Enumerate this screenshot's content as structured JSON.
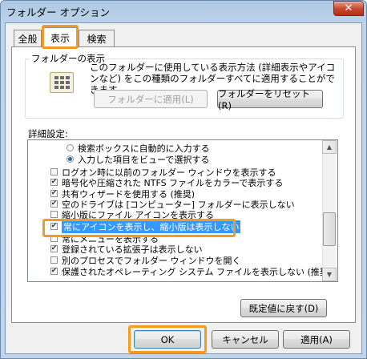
{
  "window": {
    "title": "フォルダー オプション",
    "close_glyph": "✕"
  },
  "tabs": [
    "全般",
    "表示",
    "検索"
  ],
  "folder_view": {
    "group_label": "フォルダーの表示",
    "description": "このフォルダーに使用している表示方法 (詳細表示やアイコンなど) をこの種類のフォルダーすべてに適用することができます。",
    "apply_button": "フォルダーに適用(L)",
    "reset_button": "フォルダーをリセット(R)"
  },
  "advanced": {
    "label": "詳細設定:",
    "items": [
      {
        "type": "radio",
        "checked": false,
        "label": "検索ボックスに自動的に入力する"
      },
      {
        "type": "radio",
        "checked": true,
        "label": "入力した項目をビューで選択する"
      },
      {
        "type": "checkbox",
        "checked": false,
        "label": "ログオン時に以前のフォルダー ウィンドウを表示する"
      },
      {
        "type": "checkbox",
        "checked": true,
        "label": "暗号化や圧縮された NTFS ファイルをカラーで表示する"
      },
      {
        "type": "checkbox",
        "checked": true,
        "label": "共有ウィザードを使用する (推奨)"
      },
      {
        "type": "checkbox",
        "checked": true,
        "label": "空のドライブは [コンピューター] フォルダーに表示しない"
      },
      {
        "type": "checkbox",
        "checked": false,
        "label": "縮小版にファイル アイコンを表示する"
      },
      {
        "type": "checkbox",
        "checked": true,
        "label": "常にアイコンを表示し、縮小版は表示しない"
      },
      {
        "type": "checkbox",
        "checked": false,
        "label": "常にメニューを表示する"
      },
      {
        "type": "checkbox",
        "checked": true,
        "label": "登録されている拡張子は表示しない"
      },
      {
        "type": "checkbox",
        "checked": false,
        "label": "別のプロセスでフォルダー ウィンドウを開く"
      },
      {
        "type": "checkbox",
        "checked": true,
        "label": "保護されたオペレーティング システム ファイルを表示しない (推奨)"
      }
    ],
    "restore_defaults": "既定値に戻す(D)"
  },
  "footer": {
    "ok": "OK",
    "cancel": "キャンセル",
    "apply": "適用(A)"
  },
  "check_glyph": "✔",
  "scroll": {
    "up": "▲",
    "down": "▼"
  },
  "colors": {
    "highlight": "#f39a22",
    "selection": "#3399ff"
  }
}
